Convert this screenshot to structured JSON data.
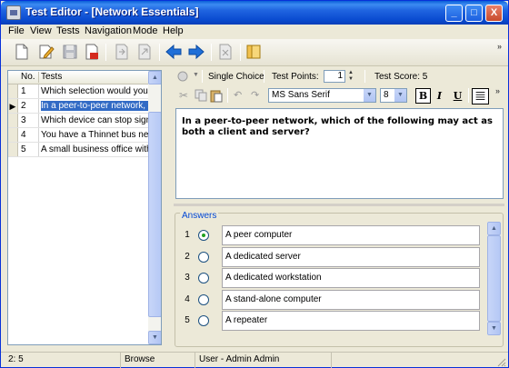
{
  "window": {
    "title": "Test Editor - [Network Essentials]"
  },
  "title_buttons": {
    "minimize": "_",
    "maximize": "□",
    "close": "X"
  },
  "menu": [
    "File",
    "View",
    "Tests",
    "Navigation",
    "Mode",
    "Help"
  ],
  "questions": {
    "headers": {
      "no": "No.",
      "tests": "Tests"
    },
    "rows": [
      {
        "no": "1",
        "text": "Which selection would you us"
      },
      {
        "no": "2",
        "text": "In a peer-to-peer network, whi"
      },
      {
        "no": "3",
        "text": "Which device can stop signa"
      },
      {
        "no": "4",
        "text": "You have a Thinnet bus netw"
      },
      {
        "no": "5",
        "text": "A small business office with se"
      }
    ],
    "selected_index": 1
  },
  "editor": {
    "question_type": "Single Choice",
    "test_points_label": "Test Points:",
    "test_points_value": "1",
    "test_score": "Test Score: 5",
    "font_name": "MS Sans Serif",
    "font_size": "8",
    "bold": "B",
    "italic": "I",
    "underline": "U"
  },
  "question_text": "In a peer-to-peer network, which of the following may act as both a client and server?",
  "answers": {
    "label": "Answers",
    "items": [
      {
        "no": "1",
        "text": "A peer computer",
        "checked": true
      },
      {
        "no": "2",
        "text": "A dedicated server",
        "checked": false
      },
      {
        "no": "3",
        "text": "A dedicated workstation",
        "checked": false
      },
      {
        "no": "4",
        "text": "A stand-alone computer",
        "checked": false
      },
      {
        "no": "5",
        "text": "A repeater",
        "checked": false
      }
    ]
  },
  "status": {
    "position": "2: 5",
    "mode": "Browse",
    "user": "User - Admin Admin"
  },
  "colors": {
    "title_blue": "#0a4bd0",
    "selection": "#316ac5",
    "answers_label": "#0046d5",
    "arrow_blue": "#1f6fd8"
  },
  "icons": [
    "new-icon",
    "edit-icon",
    "save-icon",
    "delete-icon",
    "export-icon",
    "import-icon",
    "back-arrow-icon",
    "forward-arrow-icon",
    "remove-icon",
    "book-icon"
  ]
}
